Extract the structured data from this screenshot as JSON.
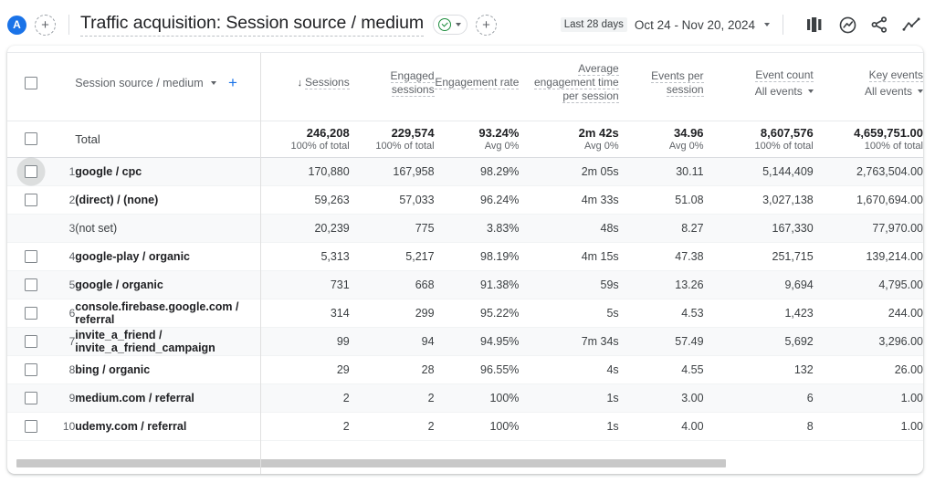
{
  "header": {
    "avatar_letter": "A",
    "add_comparison_label": "+",
    "page_title": "Traffic acquisition: Session source / medium",
    "validity_icon": "check-circle-icon",
    "validity_caret": "▾",
    "add_button_label": "+",
    "date_badge": "Last 28 days",
    "date_range": "Oct 24 - Nov 20, 2024",
    "date_caret": "▾",
    "icons": [
      {
        "name": "compare-bars-icon",
        "label": "Compare"
      },
      {
        "name": "insights-icon",
        "label": "Insights"
      },
      {
        "name": "share-icon",
        "label": "Share"
      },
      {
        "name": "explore-trend-icon",
        "label": "Explore"
      }
    ]
  },
  "table": {
    "dimension_header": "Session source / medium",
    "dimension_caret": "▾",
    "add_dimension": "+",
    "sort_arrow": "↓",
    "columns": [
      {
        "key": "sessions",
        "label": "Sessions",
        "sorted": true
      },
      {
        "key": "engaged",
        "label": "Engaged sessions"
      },
      {
        "key": "eng_rate",
        "label": "Engagement rate"
      },
      {
        "key": "avg_time",
        "label": "Average engagement time per session"
      },
      {
        "key": "events_per",
        "label": "Events per session"
      },
      {
        "key": "event_count",
        "label": "Event count",
        "sub": "All events",
        "sub_caret": "▾"
      },
      {
        "key": "key_events",
        "label": "Key events",
        "sub": "All events",
        "sub_caret": "▾"
      }
    ],
    "total": {
      "label": "Total",
      "sessions": "246,208",
      "sessions_sub": "100% of total",
      "engaged": "229,574",
      "engaged_sub": "100% of total",
      "eng_rate": "93.24%",
      "eng_rate_sub": "Avg 0%",
      "avg_time": "2m 42s",
      "avg_time_sub": "Avg 0%",
      "events_per": "34.96",
      "events_per_sub": "Avg 0%",
      "event_count": "8,607,576",
      "event_count_sub": "100% of total",
      "key_events": "4,659,751.00",
      "key_events_sub": "100% of total"
    },
    "rows": [
      {
        "rank": "1",
        "name": "google / cpc",
        "checkbox": true,
        "focused": true,
        "sessions": "170,880",
        "engaged": "167,958",
        "eng_rate": "98.29%",
        "avg_time": "2m 05s",
        "events_per": "30.11",
        "event_count": "5,144,409",
        "key_events": "2,763,504.00"
      },
      {
        "rank": "2",
        "name": "(direct) / (none)",
        "checkbox": true,
        "focused": false,
        "sessions": "59,263",
        "engaged": "57,033",
        "eng_rate": "96.24%",
        "avg_time": "4m 33s",
        "events_per": "51.08",
        "event_count": "3,027,138",
        "key_events": "1,670,694.00"
      },
      {
        "rank": "3",
        "name": "(not set)",
        "checkbox": false,
        "focused": false,
        "plain": true,
        "sessions": "20,239",
        "engaged": "775",
        "eng_rate": "3.83%",
        "avg_time": "48s",
        "events_per": "8.27",
        "event_count": "167,330",
        "key_events": "77,970.00"
      },
      {
        "rank": "4",
        "name": "google-play / organic",
        "checkbox": true,
        "focused": false,
        "sessions": "5,313",
        "engaged": "5,217",
        "eng_rate": "98.19%",
        "avg_time": "4m 15s",
        "events_per": "47.38",
        "event_count": "251,715",
        "key_events": "139,214.00"
      },
      {
        "rank": "5",
        "name": "google / organic",
        "checkbox": true,
        "focused": false,
        "sessions": "731",
        "engaged": "668",
        "eng_rate": "91.38%",
        "avg_time": "59s",
        "events_per": "13.26",
        "event_count": "9,694",
        "key_events": "4,795.00"
      },
      {
        "rank": "6",
        "name": "console.firebase.google.com / referral",
        "checkbox": true,
        "focused": false,
        "sessions": "314",
        "engaged": "299",
        "eng_rate": "95.22%",
        "avg_time": "5s",
        "events_per": "4.53",
        "event_count": "1,423",
        "key_events": "244.00"
      },
      {
        "rank": "7",
        "name": "invite_a_friend / invite_a_friend_campaign",
        "checkbox": true,
        "focused": false,
        "sessions": "99",
        "engaged": "94",
        "eng_rate": "94.95%",
        "avg_time": "7m 34s",
        "events_per": "57.49",
        "event_count": "5,692",
        "key_events": "3,296.00"
      },
      {
        "rank": "8",
        "name": "bing / organic",
        "checkbox": true,
        "focused": false,
        "sessions": "29",
        "engaged": "28",
        "eng_rate": "96.55%",
        "avg_time": "4s",
        "events_per": "4.55",
        "event_count": "132",
        "key_events": "26.00"
      },
      {
        "rank": "9",
        "name": "medium.com / referral",
        "checkbox": true,
        "focused": false,
        "sessions": "2",
        "engaged": "2",
        "eng_rate": "100%",
        "avg_time": "1s",
        "events_per": "3.00",
        "event_count": "6",
        "key_events": "1.00"
      },
      {
        "rank": "10",
        "name": "udemy.com / referral",
        "checkbox": true,
        "focused": false,
        "sessions": "2",
        "engaged": "2",
        "eng_rate": "100%",
        "avg_time": "1s",
        "events_per": "4.00",
        "event_count": "8",
        "key_events": "1.00"
      }
    ]
  },
  "colors": {
    "accent_blue": "#1a73e8",
    "valid_green": "#1e8e3e",
    "text_primary": "#202124",
    "text_secondary": "#5f6368",
    "alt_row": "#f8f9fa"
  }
}
